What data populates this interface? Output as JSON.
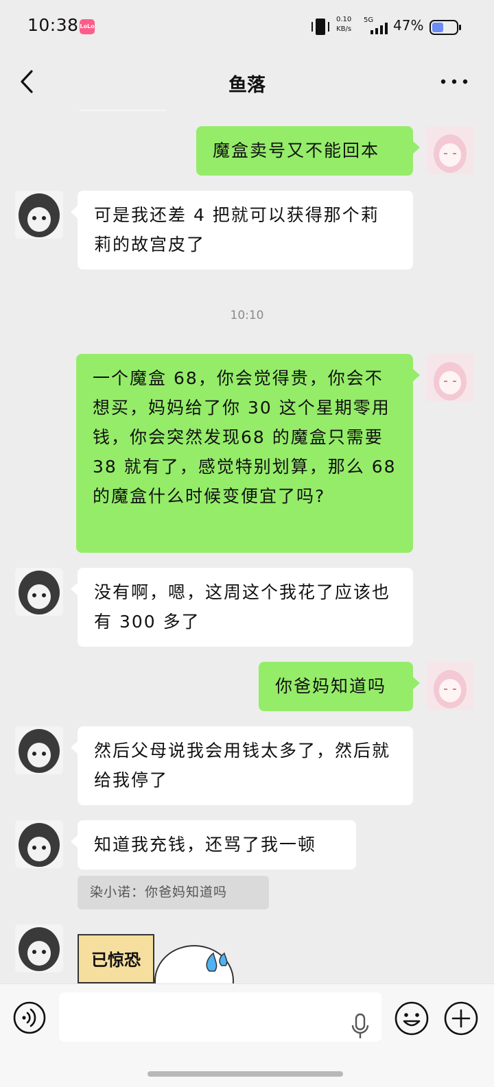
{
  "status_bar": {
    "time": "10:38",
    "app_badge": "LoLo",
    "net_speed_value": "0.10",
    "net_speed_unit": "KB/s",
    "signal_label": "5G",
    "battery_percent": "47%",
    "battery_level": 0.47
  },
  "header": {
    "title": "鱼落"
  },
  "messages": [
    {
      "side": "out",
      "text": "魔盒卖号又不能回本"
    },
    {
      "side": "in",
      "text": "可是我还差 4 把就可以获得那个莉莉的故宫皮了"
    },
    {
      "side": "out",
      "text": "一个魔盒 68，你会觉得贵，你会不想买，妈妈给了你 30 这个星期零用钱，你会突然发现68 的魔盒只需要 38 就有了，感觉特别划算，那么 68 的魔盒什么时候变便宜了吗?"
    },
    {
      "side": "in",
      "text": "没有啊，嗯，这周这个我花了应该也有 300 多了"
    },
    {
      "side": "out",
      "text": "你爸妈知道吗"
    },
    {
      "side": "in",
      "text": "然后父母说我会用钱太多了，然后就给我停了"
    },
    {
      "side": "in",
      "text": "知道我充钱，还骂了我一顿"
    }
  ],
  "timestamp": "10:10",
  "quote": "染小诺：你爸妈知道吗",
  "sticker_text": "已惊恐",
  "colors": {
    "background": "#ededed",
    "incoming_bubble": "#ffffff",
    "outgoing_bubble": "#95ec69"
  },
  "icons": {
    "back": "chevron-left-icon",
    "more": "more-dots-icon",
    "voice": "voice-icon",
    "mic": "mic-icon",
    "emoji": "emoji-icon",
    "plus": "plus-icon"
  }
}
